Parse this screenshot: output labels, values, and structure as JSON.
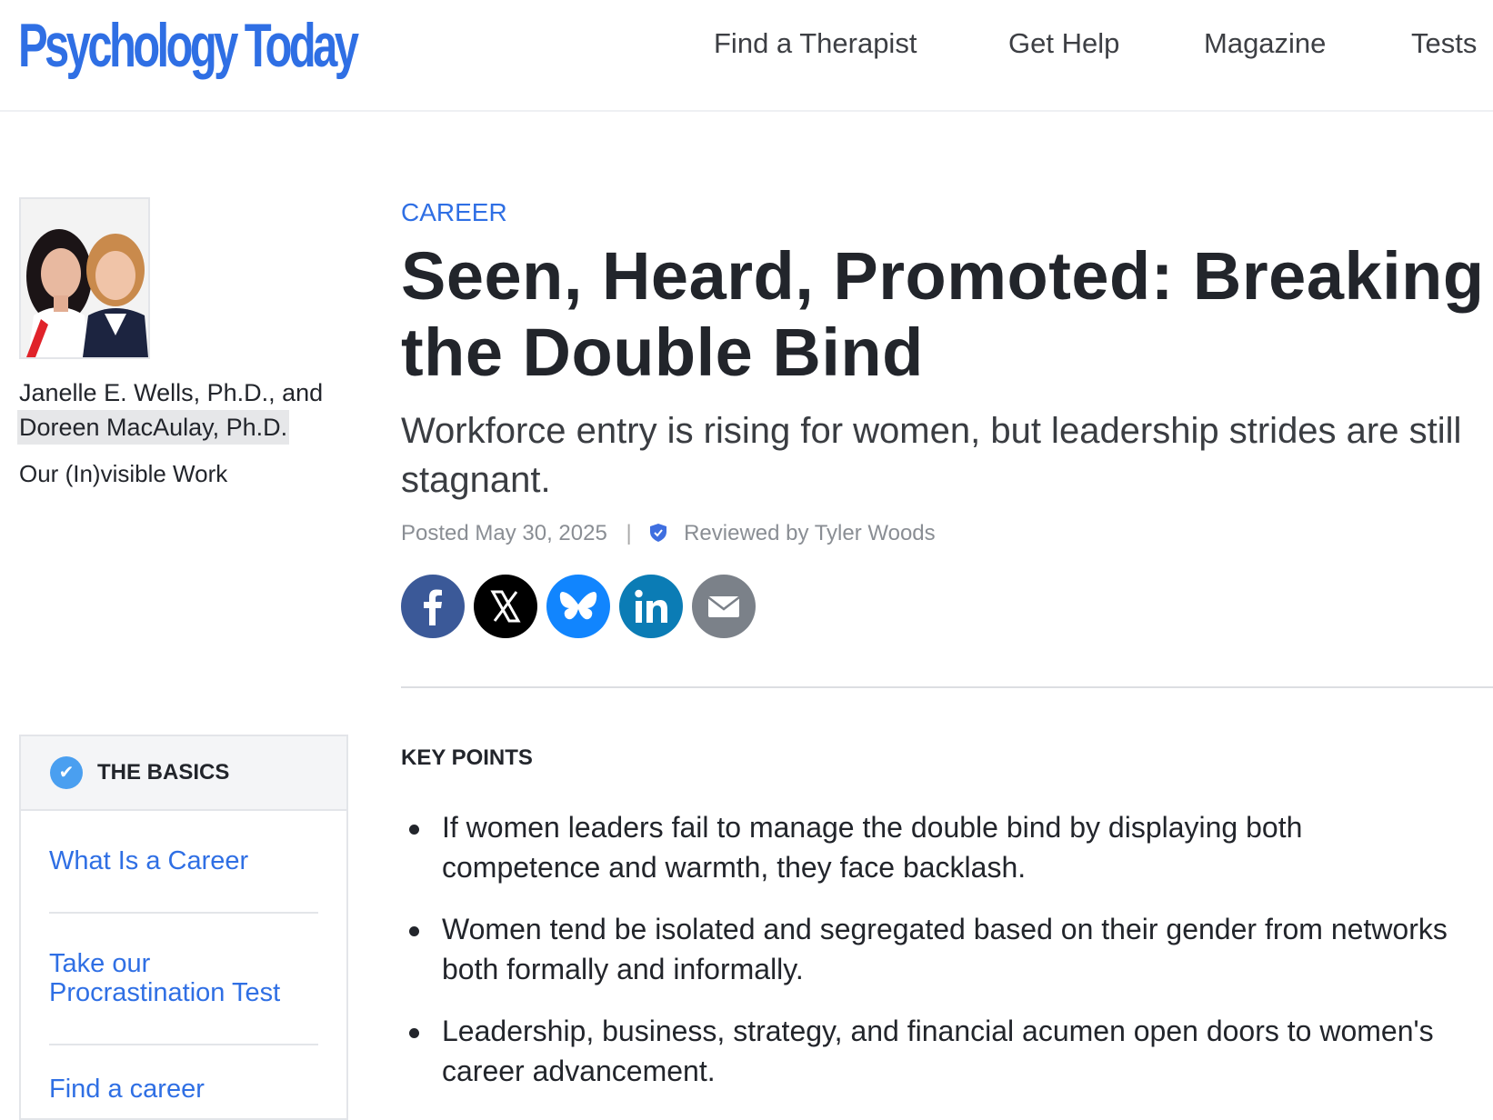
{
  "header": {
    "logo": "Psychology Today",
    "nav": [
      "Find a Therapist",
      "Get Help",
      "Magazine",
      "Tests"
    ]
  },
  "sidebar": {
    "author_line1": "Janelle E. Wells, Ph.D., and",
    "author_line2": "Doreen MacAulay, Ph.D.",
    "blog": "Our (In)visible Work",
    "basics": {
      "title": "THE BASICS",
      "links": [
        "What Is a Career",
        "Take our Procrastination Test",
        "Find a career"
      ]
    }
  },
  "article": {
    "category": "CAREER",
    "title": "Seen, Heard, Promoted: Breaking the Double Bind",
    "subtitle": "Workforce entry is rising for women, but leadership strides are still stagnant.",
    "posted": "Posted May 30, 2025",
    "separator": "|",
    "reviewed": "Reviewed by Tyler Woods",
    "share_icons": [
      "facebook-icon",
      "x-icon",
      "bluesky-icon",
      "linkedin-icon",
      "email-icon"
    ],
    "key_points_title": "KEY POINTS",
    "key_points": [
      "If women leaders fail to manage the double bind by displaying both competence and warmth, they face backlash.",
      "Women tend be isolated and segregated based on their gender from networks both formally and informally.",
      "Leadership, business, strategy, and financial acumen open doors to women's career advancement."
    ]
  },
  "colors": {
    "brand_blue": "#2f6fe4",
    "facebook": "#3b5998",
    "x": "#000000",
    "bluesky": "#1185fe",
    "linkedin": "#0b7cb5",
    "email": "#7b8189"
  }
}
